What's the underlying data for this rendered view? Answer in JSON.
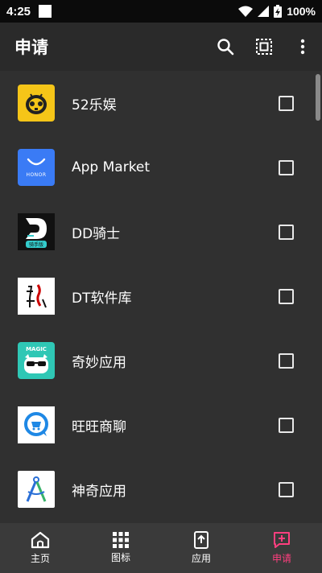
{
  "status": {
    "time": "4:25",
    "battery": "100%"
  },
  "appbar": {
    "title": "申请"
  },
  "apps": [
    {
      "name": "52乐娱"
    },
    {
      "name": "App Market"
    },
    {
      "name": "DD骑士"
    },
    {
      "name": "DT软件库"
    },
    {
      "name": "奇妙应用"
    },
    {
      "name": "旺旺商聊"
    },
    {
      "name": "神奇应用"
    }
  ],
  "icon_text": {
    "honor": "HONOR",
    "magic": "MAGIC",
    "dd_sub": "骑手版"
  },
  "nav": {
    "items": [
      {
        "label": "主页"
      },
      {
        "label": "图标"
      },
      {
        "label": "应用"
      },
      {
        "label": "申请"
      }
    ],
    "active_color": "#ff3f7f"
  }
}
